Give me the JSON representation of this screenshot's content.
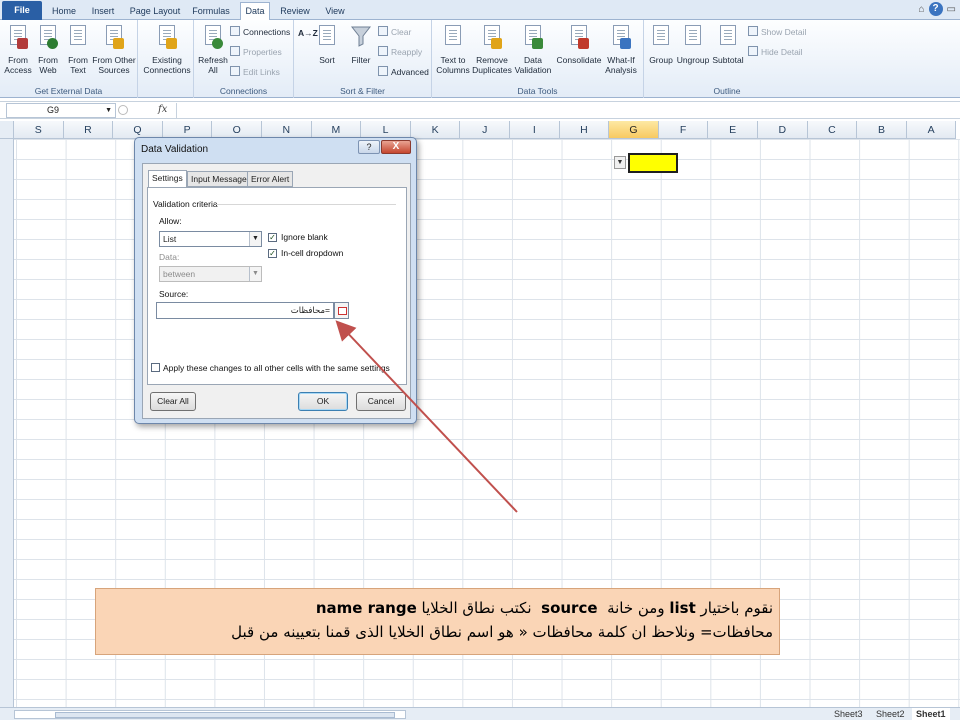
{
  "ribbon_tabs": [
    "File",
    "Home",
    "Insert",
    "Page Layout",
    "Formulas",
    "Data",
    "Review",
    "View"
  ],
  "active_tab": "Data",
  "groups": {
    "external": {
      "label": "Get External Data",
      "from_access": "From Access",
      "from_web": "From Web",
      "from_text": "From Text",
      "from_other": "From Other Sources",
      "existing": "Existing Connections"
    },
    "connections": {
      "label": "Connections",
      "refresh": "Refresh All",
      "connections": "Connections",
      "properties": "Properties",
      "edit_links": "Edit Links"
    },
    "sortfilter": {
      "label": "Sort & Filter",
      "sort_az": "A→Z",
      "sort": "Sort",
      "filter": "Filter",
      "clear": "Clear",
      "reapply": "Reapply",
      "advanced": "Advanced"
    },
    "datatools": {
      "label": "Data Tools",
      "text_to_columns": "Text to Columns",
      "remove_duplicates": "Remove Duplicates",
      "data_validation": "Data Validation",
      "consolidate": "Consolidate",
      "whatif": "What-If Analysis"
    },
    "outline": {
      "label": "Outline",
      "group": "Group",
      "ungroup": "Ungroup",
      "subtotal": "Subtotal",
      "show_detail": "Show Detail",
      "hide_detail": "Hide Detail"
    }
  },
  "formula_bar": {
    "name_box": "G9",
    "fx": "fx",
    "formula": ""
  },
  "columns": [
    "S",
    "R",
    "Q",
    "P",
    "O",
    "N",
    "M",
    "L",
    "K",
    "J",
    "I",
    "H",
    "G",
    "F",
    "E",
    "D",
    "C",
    "B",
    "A"
  ],
  "selected_column": "G",
  "sheet_tabs": [
    "Sheet3",
    "Sheet2",
    "Sheet1"
  ],
  "active_sheet": "Sheet1",
  "dialog": {
    "title": "Data Validation",
    "help": "?",
    "close": "X",
    "tabs": [
      "Settings",
      "Input Message",
      "Error Alert"
    ],
    "validation_criteria": "Validation criteria",
    "allow_label": "Allow:",
    "allow_value": "List",
    "ignore_blank": "Ignore blank",
    "in_cell_dropdown": "In-cell dropdown",
    "data_label": "Data:",
    "data_value": "between",
    "source_label": "Source:",
    "source_value": "=محافظات",
    "apply_all": "Apply these changes to all other cells with the same settings",
    "clear_all": "Clear All",
    "ok": "OK",
    "cancel": "Cancel"
  },
  "annotation": {
    "line1_a": "نقوم باختيار",
    "line1_list": "list",
    "line1_b": "ومن خانة",
    "line1_source": "source",
    "line1_c": "نكتب نطاق الخلايا",
    "line1_name_range": "name range",
    "line2": "محافظات= ونلاحظ ان كلمة محافظات « هو اسم نطاق الخلايا الذى قمنا بتعيينه من قبل"
  },
  "colors": {
    "arrow": "#c0504d",
    "selected_cell": "#ffff00",
    "note_bg": "#fad5b6"
  }
}
